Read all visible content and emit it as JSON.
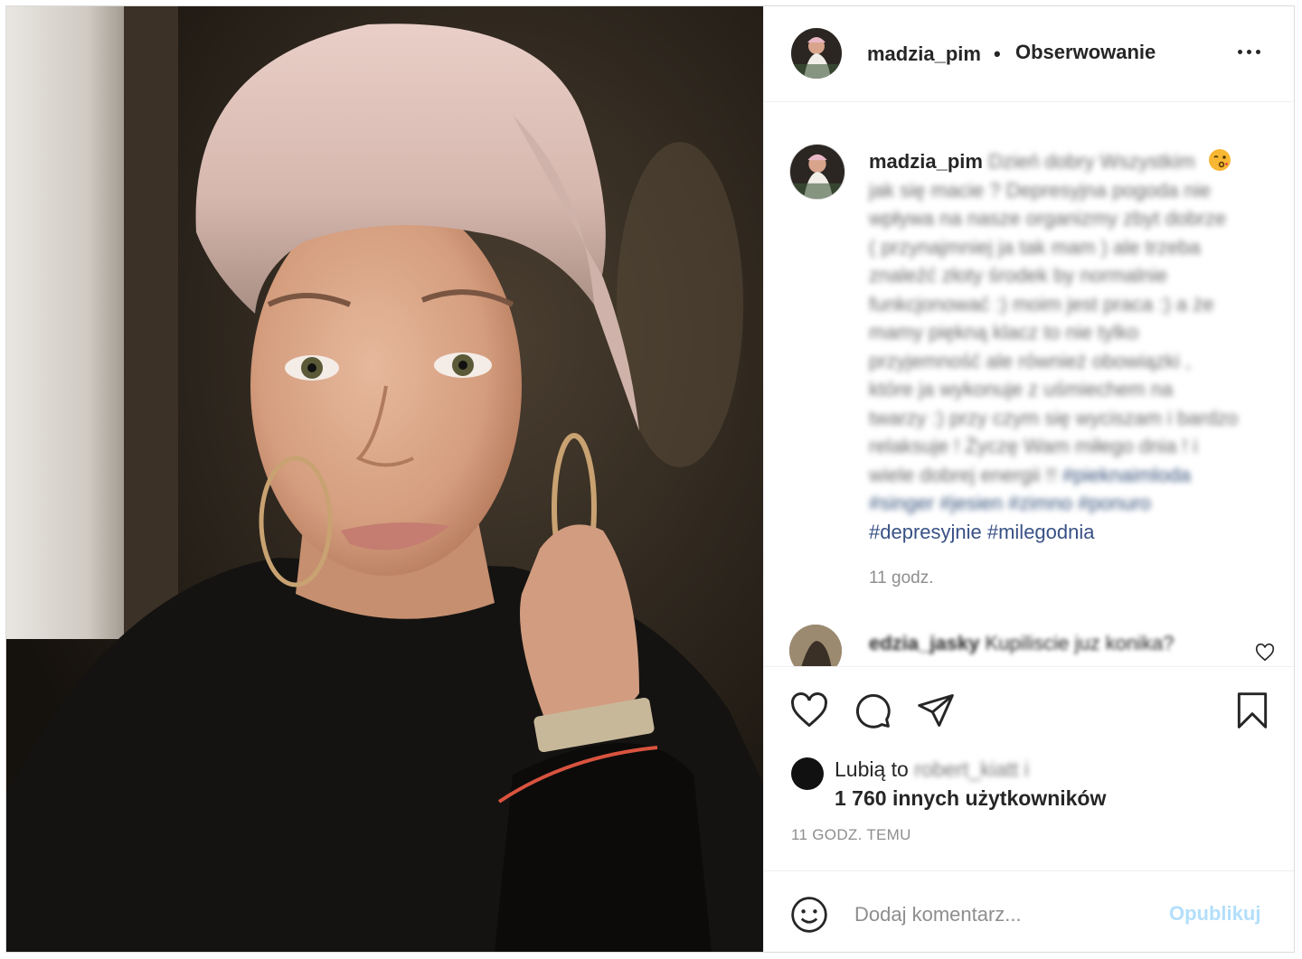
{
  "post": {
    "username": "madzia_pim",
    "separator": "•",
    "follow_status": "Obserwowanie",
    "more_options_icon": "more-horizontal-icon"
  },
  "caption": {
    "username": "madzia_pim",
    "text_lines": [
      "Dzień dobry Wszystkim",
      "jak się macie ? Depresyjna pogoda nie",
      "wpływa na nasze organizmy zbyt dobrze",
      "( przynajmniej ja tak mam ) ale trzeba",
      "znaleźć złoty środek by normalnie",
      "funkcjonować :) moim jest praca :) a że",
      "mamy piękną klacz to nie tylko",
      "przyjemność ale również obowiązki ,",
      "które ja wykonuje z uśmiechem na",
      "twarzy :) przy czym się wyciszam i bardzo",
      "relaksuje ! Życzę Wam miłego dnia ! i",
      "wiele dobrej energii !!"
    ],
    "hashtags_blurred_1": "#pieknaimloda",
    "hashtags_blurred_2": "#singer #jesien #zimno #ponuro",
    "hashtags_visible": "#depresyjnie #milegodnia",
    "emoji_icon": "wink-kiss-emoji-icon",
    "time": "11 godz."
  },
  "comment": {
    "username": "edzia_jasky",
    "text": "Kupiliscie juz konika?",
    "like_icon": "heart-outline-icon"
  },
  "actions": {
    "like_icon": "heart-icon",
    "comment_icon": "comment-bubble-icon",
    "share_icon": "paper-plane-icon",
    "save_icon": "bookmark-icon"
  },
  "likes": {
    "prefix": "Lubią to",
    "blurred_user": "robert_kiatt i",
    "others": "1 760 innych użytkowników"
  },
  "timestamp": "11 GODZ. TEMU",
  "add_comment": {
    "placeholder": "Dodaj komentarz...",
    "publish_label": "Opublikuj",
    "emoji_icon": "smiley-icon"
  },
  "colors": {
    "text": "#262626",
    "muted": "#8e8e8e",
    "hashtag": "#385185",
    "publish_disabled": "#b2dffc",
    "border": "#efefef"
  }
}
